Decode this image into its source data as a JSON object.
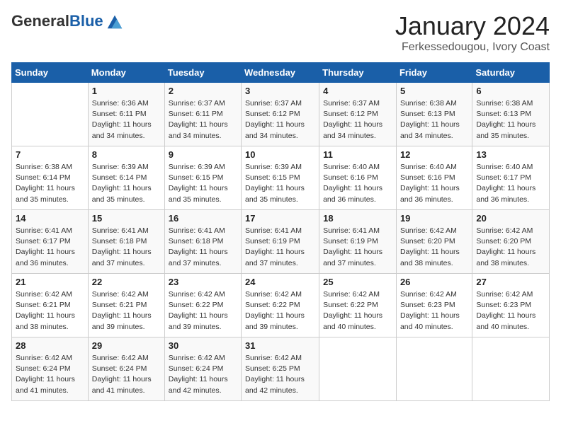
{
  "header": {
    "logo_general": "General",
    "logo_blue": "Blue",
    "title": "January 2024",
    "subtitle": "Ferkessedougou, Ivory Coast"
  },
  "days_of_week": [
    "Sunday",
    "Monday",
    "Tuesday",
    "Wednesday",
    "Thursday",
    "Friday",
    "Saturday"
  ],
  "weeks": [
    [
      {
        "num": "",
        "info": ""
      },
      {
        "num": "1",
        "info": "Sunrise: 6:36 AM\nSunset: 6:11 PM\nDaylight: 11 hours\nand 34 minutes."
      },
      {
        "num": "2",
        "info": "Sunrise: 6:37 AM\nSunset: 6:11 PM\nDaylight: 11 hours\nand 34 minutes."
      },
      {
        "num": "3",
        "info": "Sunrise: 6:37 AM\nSunset: 6:12 PM\nDaylight: 11 hours\nand 34 minutes."
      },
      {
        "num": "4",
        "info": "Sunrise: 6:37 AM\nSunset: 6:12 PM\nDaylight: 11 hours\nand 34 minutes."
      },
      {
        "num": "5",
        "info": "Sunrise: 6:38 AM\nSunset: 6:13 PM\nDaylight: 11 hours\nand 34 minutes."
      },
      {
        "num": "6",
        "info": "Sunrise: 6:38 AM\nSunset: 6:13 PM\nDaylight: 11 hours\nand 35 minutes."
      }
    ],
    [
      {
        "num": "7",
        "info": "Sunrise: 6:38 AM\nSunset: 6:14 PM\nDaylight: 11 hours\nand 35 minutes."
      },
      {
        "num": "8",
        "info": "Sunrise: 6:39 AM\nSunset: 6:14 PM\nDaylight: 11 hours\nand 35 minutes."
      },
      {
        "num": "9",
        "info": "Sunrise: 6:39 AM\nSunset: 6:15 PM\nDaylight: 11 hours\nand 35 minutes."
      },
      {
        "num": "10",
        "info": "Sunrise: 6:39 AM\nSunset: 6:15 PM\nDaylight: 11 hours\nand 35 minutes."
      },
      {
        "num": "11",
        "info": "Sunrise: 6:40 AM\nSunset: 6:16 PM\nDaylight: 11 hours\nand 36 minutes."
      },
      {
        "num": "12",
        "info": "Sunrise: 6:40 AM\nSunset: 6:16 PM\nDaylight: 11 hours\nand 36 minutes."
      },
      {
        "num": "13",
        "info": "Sunrise: 6:40 AM\nSunset: 6:17 PM\nDaylight: 11 hours\nand 36 minutes."
      }
    ],
    [
      {
        "num": "14",
        "info": "Sunrise: 6:41 AM\nSunset: 6:17 PM\nDaylight: 11 hours\nand 36 minutes."
      },
      {
        "num": "15",
        "info": "Sunrise: 6:41 AM\nSunset: 6:18 PM\nDaylight: 11 hours\nand 37 minutes."
      },
      {
        "num": "16",
        "info": "Sunrise: 6:41 AM\nSunset: 6:18 PM\nDaylight: 11 hours\nand 37 minutes."
      },
      {
        "num": "17",
        "info": "Sunrise: 6:41 AM\nSunset: 6:19 PM\nDaylight: 11 hours\nand 37 minutes."
      },
      {
        "num": "18",
        "info": "Sunrise: 6:41 AM\nSunset: 6:19 PM\nDaylight: 11 hours\nand 37 minutes."
      },
      {
        "num": "19",
        "info": "Sunrise: 6:42 AM\nSunset: 6:20 PM\nDaylight: 11 hours\nand 38 minutes."
      },
      {
        "num": "20",
        "info": "Sunrise: 6:42 AM\nSunset: 6:20 PM\nDaylight: 11 hours\nand 38 minutes."
      }
    ],
    [
      {
        "num": "21",
        "info": "Sunrise: 6:42 AM\nSunset: 6:21 PM\nDaylight: 11 hours\nand 38 minutes."
      },
      {
        "num": "22",
        "info": "Sunrise: 6:42 AM\nSunset: 6:21 PM\nDaylight: 11 hours\nand 39 minutes."
      },
      {
        "num": "23",
        "info": "Sunrise: 6:42 AM\nSunset: 6:22 PM\nDaylight: 11 hours\nand 39 minutes."
      },
      {
        "num": "24",
        "info": "Sunrise: 6:42 AM\nSunset: 6:22 PM\nDaylight: 11 hours\nand 39 minutes."
      },
      {
        "num": "25",
        "info": "Sunrise: 6:42 AM\nSunset: 6:22 PM\nDaylight: 11 hours\nand 40 minutes."
      },
      {
        "num": "26",
        "info": "Sunrise: 6:42 AM\nSunset: 6:23 PM\nDaylight: 11 hours\nand 40 minutes."
      },
      {
        "num": "27",
        "info": "Sunrise: 6:42 AM\nSunset: 6:23 PM\nDaylight: 11 hours\nand 40 minutes."
      }
    ],
    [
      {
        "num": "28",
        "info": "Sunrise: 6:42 AM\nSunset: 6:24 PM\nDaylight: 11 hours\nand 41 minutes."
      },
      {
        "num": "29",
        "info": "Sunrise: 6:42 AM\nSunset: 6:24 PM\nDaylight: 11 hours\nand 41 minutes."
      },
      {
        "num": "30",
        "info": "Sunrise: 6:42 AM\nSunset: 6:24 PM\nDaylight: 11 hours\nand 42 minutes."
      },
      {
        "num": "31",
        "info": "Sunrise: 6:42 AM\nSunset: 6:25 PM\nDaylight: 11 hours\nand 42 minutes."
      },
      {
        "num": "",
        "info": ""
      },
      {
        "num": "",
        "info": ""
      },
      {
        "num": "",
        "info": ""
      }
    ]
  ]
}
